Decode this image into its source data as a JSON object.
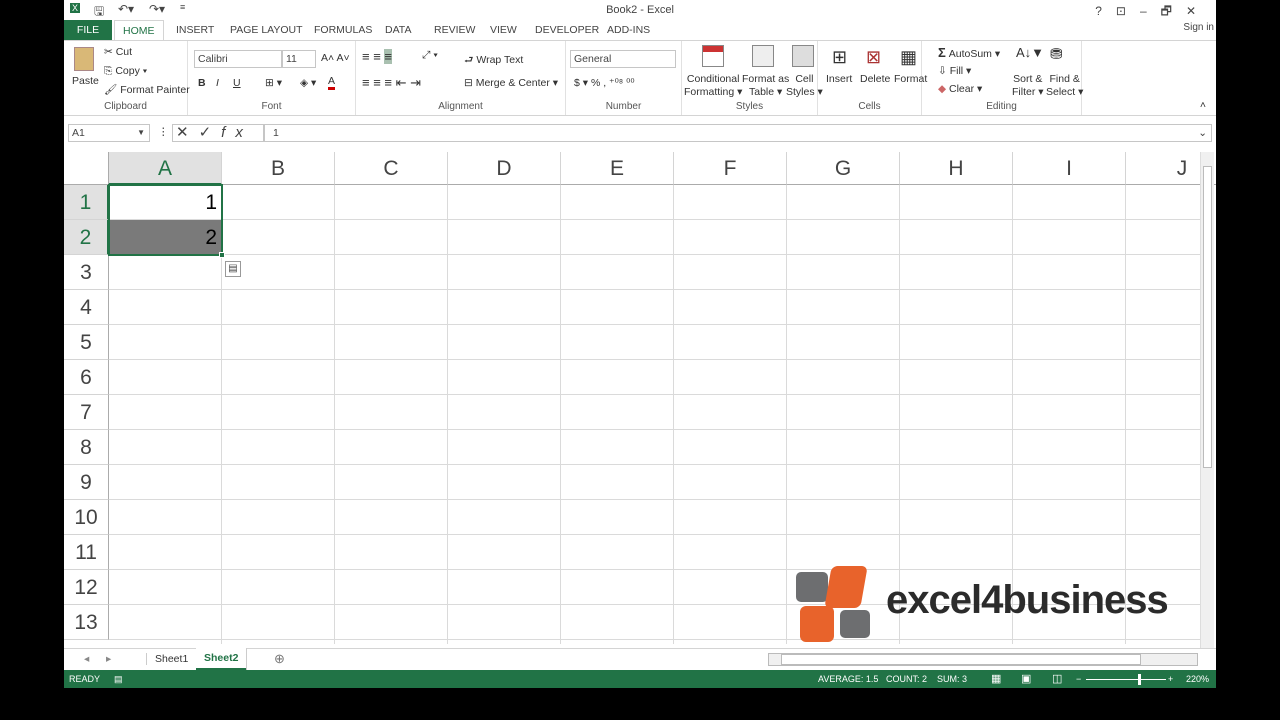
{
  "window": {
    "title": "Book2 - Excel",
    "sign_in": "Sign in",
    "controls": [
      "?",
      "⊡",
      "–",
      "🗗",
      "✕"
    ]
  },
  "qat": {
    "icons": [
      "excel-logo-icon",
      "save-icon",
      "undo-icon",
      "redo-icon",
      "customize-qat-icon"
    ]
  },
  "tabs": [
    {
      "label": "FILE"
    },
    {
      "label": "HOME",
      "active": true
    },
    {
      "label": "INSERT"
    },
    {
      "label": "PAGE LAYOUT"
    },
    {
      "label": "FORMULAS"
    },
    {
      "label": "DATA"
    },
    {
      "label": "REVIEW"
    },
    {
      "label": "VIEW"
    },
    {
      "label": "DEVELOPER"
    },
    {
      "label": "ADD-INS"
    }
  ],
  "ribbon": {
    "clipboard": {
      "label": "Clipboard",
      "paste": "Paste",
      "cut": "Cut",
      "copy": "Copy",
      "format_painter": "Format Painter"
    },
    "font": {
      "label": "Font",
      "font_name": "Calibri",
      "font_size": "11",
      "bold": "B",
      "italic": "I",
      "underline": "U"
    },
    "alignment": {
      "label": "Alignment",
      "wrap_text": "Wrap Text",
      "merge_center": "Merge & Center"
    },
    "number": {
      "label": "Number",
      "format": "General",
      "currency": "$",
      "percent": "%",
      "comma": ","
    },
    "styles": {
      "label": "Styles",
      "conditional": [
        "Conditional",
        "Formatting ▾"
      ],
      "format_table": [
        "Format as",
        "Table ▾"
      ],
      "cell_styles": [
        "Cell",
        "Styles ▾"
      ]
    },
    "cells": {
      "label": "Cells",
      "insert": "Insert",
      "delete": "Delete",
      "format": "Format"
    },
    "editing": {
      "label": "Editing",
      "autosum": "AutoSum",
      "fill": "Fill ▾",
      "clear": "Clear ▾",
      "sort": [
        "Sort &",
        "Filter ▾"
      ],
      "find": [
        "Find &",
        "Select ▾"
      ]
    }
  },
  "formula_bar": {
    "name_box": "A1",
    "fx": "fx",
    "value": "1"
  },
  "grid": {
    "columns": [
      "A",
      "B",
      "C",
      "D",
      "E",
      "F",
      "G",
      "H",
      "I",
      "J"
    ],
    "rows": [
      "1",
      "2",
      "3",
      "4",
      "5",
      "6",
      "7",
      "8",
      "9",
      "10",
      "11",
      "12",
      "13"
    ],
    "selected_column": "A",
    "selected_rows": [
      "1",
      "2"
    ],
    "cells": {
      "A1": "1",
      "A2": "2"
    }
  },
  "sheets": [
    {
      "label": "Sheet1"
    },
    {
      "label": "Sheet2",
      "active": true
    }
  ],
  "status": {
    "ready": "READY",
    "average": "AVERAGE: 1.5",
    "count": "COUNT: 2",
    "sum": "SUM: 3",
    "zoom": "220%"
  },
  "watermark": {
    "text": "excel4business",
    "colors": {
      "orange": "#e8632b",
      "gray": "#6d6e70"
    }
  },
  "colors": {
    "accent": "#217346",
    "selection": "#7a7a7a"
  }
}
